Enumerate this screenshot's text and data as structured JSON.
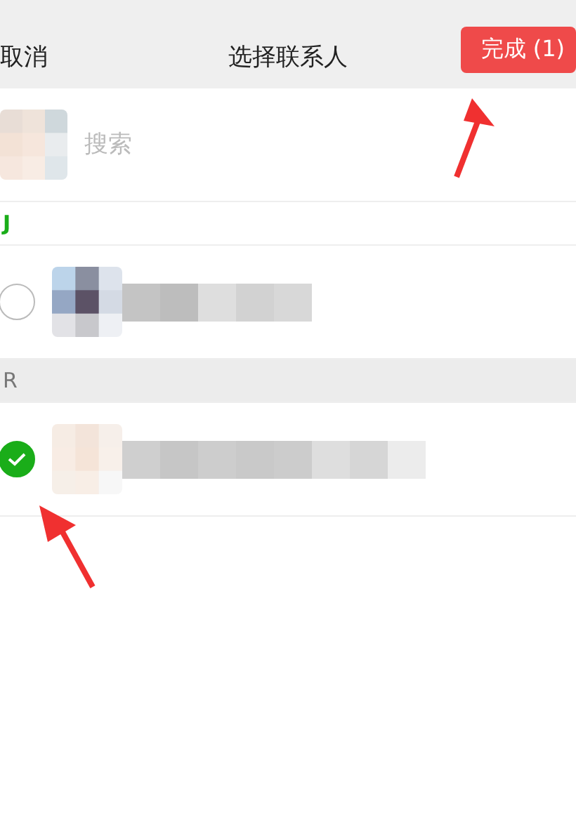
{
  "nav": {
    "cancel": "取消",
    "title": "选择联系人",
    "done": "完成 (1)"
  },
  "search": {
    "placeholder": "搜索"
  },
  "sections": [
    {
      "letter": "J",
      "active": true,
      "contacts": [
        {
          "selected": false
        }
      ]
    },
    {
      "letter": "R",
      "active": false,
      "contacts": [
        {
          "selected": true
        }
      ]
    }
  ]
}
